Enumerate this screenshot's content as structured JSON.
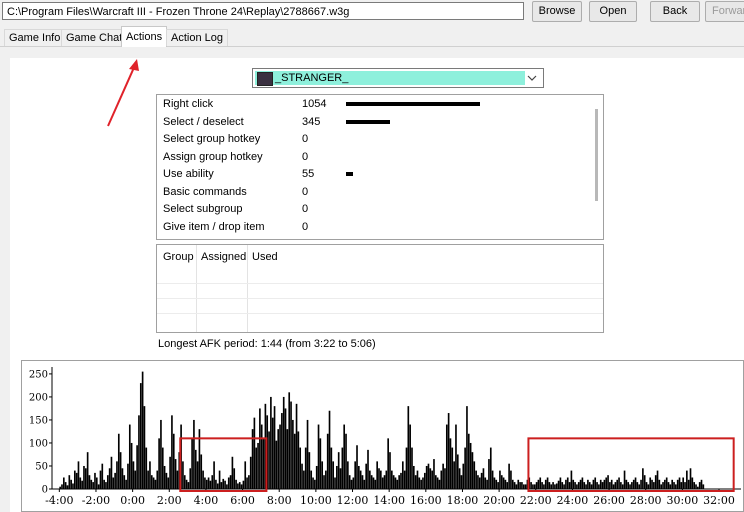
{
  "toolbar": {
    "path": "C:\\Program Files\\Warcraft III - Frozen Throne 24\\Replay\\2788667.w3g",
    "browse": "Browse",
    "open": "Open",
    "back": "Back",
    "forward": "Forward"
  },
  "tabs": [
    {
      "label": "Game Info"
    },
    {
      "label": "Game Chat"
    },
    {
      "label": "Actions"
    },
    {
      "label": "Action Log"
    }
  ],
  "player": {
    "name": "_STRANGER_",
    "highlight_color": "#8ef0dc"
  },
  "actions": [
    {
      "label": "Right click",
      "count": "1054",
      "value": 1054
    },
    {
      "label": "Select / deselect",
      "count": "345",
      "value": 345
    },
    {
      "label": "Select group hotkey",
      "count": "0",
      "value": 0
    },
    {
      "label": "Assign group hotkey",
      "count": "0",
      "value": 0
    },
    {
      "label": "Use ability",
      "count": "55",
      "value": 55
    },
    {
      "label": "Basic commands",
      "count": "0",
      "value": 0
    },
    {
      "label": "Select subgroup",
      "count": "0",
      "value": 0
    },
    {
      "label": "Give item / drop item",
      "count": "0",
      "value": 0
    }
  ],
  "hotkeys": {
    "headers": [
      "Group",
      "Assigned",
      "Used"
    ]
  },
  "afk": "Longest AFK period: 1:44 (from 3:22 to 5:06)",
  "annotation_colors": {
    "arrow": "#e0222a",
    "highlight_box": "#cc1f1f"
  },
  "chart_data": {
    "type": "bar",
    "y_ticks": [
      "250",
      "200",
      "150",
      "100",
      "50",
      "0"
    ],
    "y_values": [
      250,
      200,
      150,
      100,
      50,
      0
    ],
    "ylim": [
      0,
      265
    ],
    "x_ticks": [
      "-4:00",
      "-2:00",
      "0:00",
      "2:00",
      "4:00",
      "6:00",
      "8:00",
      "10:00",
      "12:00",
      "14:00",
      "16:00",
      "18:00",
      "20:00",
      "22:00",
      "24:00",
      "26:00",
      "28:00",
      "30:00",
      "32:00"
    ],
    "x_tick_minutes": [
      -4,
      -2,
      0,
      2,
      4,
      6,
      8,
      10,
      12,
      14,
      16,
      18,
      20,
      22,
      24,
      26,
      28,
      30,
      32
    ],
    "xlim_minutes": [
      -4.4,
      33.2
    ],
    "bar_color": "#000000",
    "highlight_ranges_minutes": [
      [
        2.6,
        7.3
      ],
      [
        21.6,
        32.8
      ]
    ],
    "bar_width_minutes": 0.09,
    "series": [
      {
        "x_start_minutes": -4.0,
        "x_step_minutes": 0.1,
        "values": [
          5,
          10,
          25,
          15,
          8,
          30,
          20,
          12,
          40,
          35,
          60,
          25,
          18,
          50,
          45,
          80,
          30,
          20,
          15,
          35,
          25,
          10,
          40,
          55,
          20,
          15,
          30,
          45,
          70,
          25,
          35,
          60,
          120,
          80,
          45,
          30,
          20,
          55,
          140,
          100,
          60,
          40,
          95,
          160,
          230,
          255,
          180,
          90,
          40,
          60,
          30,
          25,
          20,
          40,
          110,
          150,
          90,
          50,
          35,
          25,
          70,
          160,
          120,
          65,
          40,
          80,
          140,
          60,
          30,
          20,
          15,
          45,
          110,
          150,
          85,
          60,
          130,
          75,
          40,
          25,
          20,
          25,
          18,
          30,
          60,
          20,
          12,
          40,
          15,
          22,
          18,
          10,
          25,
          30,
          70,
          45,
          20,
          12,
          15,
          10,
          18,
          60,
          25,
          30,
          70,
          130,
          155,
          90,
          100,
          175,
          140,
          110,
          185,
          160,
          125,
          200,
          155,
          180,
          105,
          130,
          140,
          165,
          200,
          175,
          130,
          210,
          190,
          150,
          120,
          185,
          125,
          90,
          55,
          40,
          90,
          150,
          80,
          40,
          25,
          20,
          50,
          140,
          110,
          60,
          30,
          40,
          120,
          170,
          90,
          60,
          25,
          50,
          80,
          45,
          90,
          140,
          120,
          60,
          30,
          20,
          25,
          60,
          95,
          50,
          40,
          30,
          20,
          55,
          85,
          40,
          30,
          25,
          20,
          60,
          45,
          40,
          25,
          30,
          40,
          110,
          80,
          40,
          30,
          25,
          20,
          30,
          35,
          60,
          40,
          90,
          180,
          140,
          90,
          50,
          30,
          40,
          25,
          20,
          25,
          35,
          50,
          55,
          45,
          40,
          65,
          30,
          25,
          20,
          40,
          55,
          45,
          140,
          165,
          110,
          90,
          60,
          140,
          75,
          45,
          30,
          55,
          90,
          180,
          120,
          100,
          80,
          60,
          40,
          30,
          25,
          35,
          45,
          25,
          20,
          65,
          90,
          40,
          25,
          20,
          15,
          40,
          30,
          25,
          20,
          15,
          55,
          40,
          20,
          15,
          10,
          20,
          15,
          15,
          10,
          10,
          20,
          25,
          15,
          10,
          10,
          15,
          20,
          25,
          15,
          10,
          20,
          25,
          15,
          10,
          15,
          10,
          12,
          18,
          25,
          15,
          10,
          20,
          25,
          15,
          40,
          20,
          15,
          10,
          15,
          20,
          25,
          15,
          10,
          20,
          15,
          10,
          20,
          25,
          15,
          10,
          20,
          15,
          20,
          25,
          30,
          15,
          20,
          10,
          15,
          20,
          25,
          15,
          10,
          40,
          20,
          15,
          10,
          15,
          20,
          25,
          15,
          10,
          20,
          45,
          30,
          15,
          10,
          25,
          20,
          15,
          30,
          40,
          20,
          10,
          15,
          20,
          25,
          15,
          10,
          20,
          15,
          10,
          20,
          25,
          15,
          25,
          15,
          40,
          20,
          45,
          25,
          15,
          10,
          5,
          15,
          20,
          10
        ]
      }
    ]
  }
}
